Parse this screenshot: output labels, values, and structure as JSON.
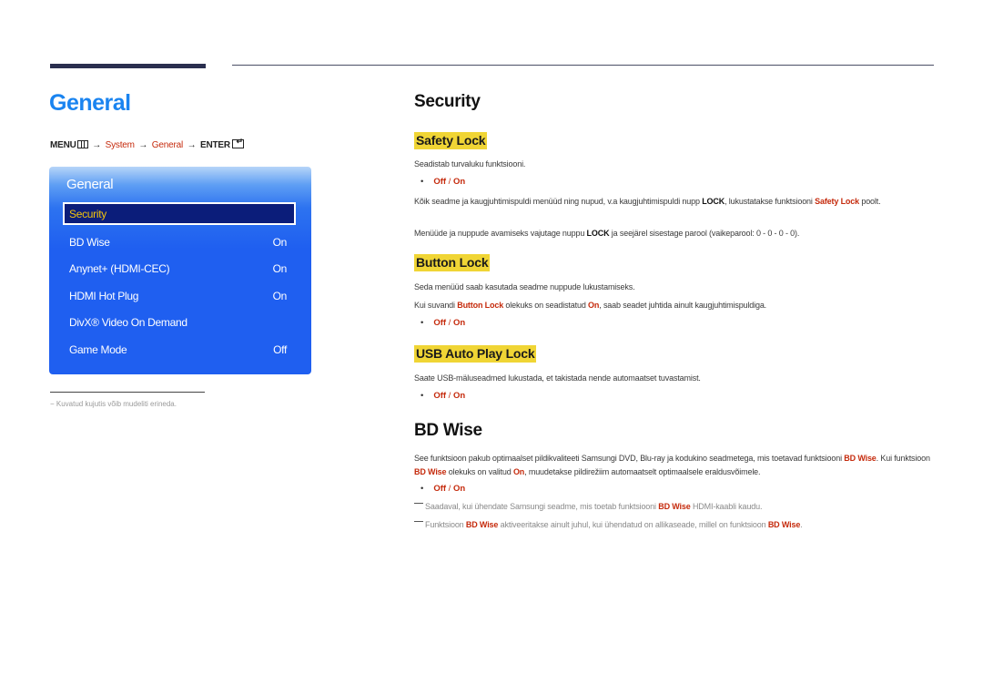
{
  "left": {
    "title": "General",
    "menu_path": {
      "menu": "MENU",
      "arrow": "→",
      "system": "System",
      "general": "General",
      "enter": "ENTER"
    },
    "osd": {
      "title": "General",
      "items": [
        {
          "label": "Security",
          "value": "",
          "selected": true
        },
        {
          "label": "BD Wise",
          "value": "On"
        },
        {
          "label": "Anynet+ (HDMI-CEC)",
          "value": "On"
        },
        {
          "label": "HDMI Hot Plug",
          "value": "On"
        },
        {
          "label": "DivX® Video On Demand",
          "value": ""
        },
        {
          "label": "Game Mode",
          "value": "Off"
        }
      ]
    },
    "footnote": "−  Kuvatud kujutis võib mudeliti erineda."
  },
  "security": {
    "title": "Security",
    "safety_lock": {
      "title": "Safety Lock",
      "desc": "Seadistab turvaluku funktsiooni.",
      "options": {
        "off": "Off",
        "sep": " / ",
        "on": "On"
      },
      "para1_a": "Kõik seadme ja kaugjuhtimispuldi menüüd ning nupud, v.a kaugjuhtimispuldi nupp ",
      "para1_lock": "LOCK",
      "para1_b": ", lukustatakse funktsiooni ",
      "para1_red": "Safety Lock",
      "para1_c": " poolt.",
      "para2_a": "Menüüde ja nuppude avamiseks vajutage nuppu ",
      "para2_lock": "LOCK",
      "para2_b": " ja seejärel sisestage parool (vaikeparool: 0 - 0 - 0 - 0)."
    },
    "button_lock": {
      "title": "Button Lock",
      "desc": "Seda menüüd saab kasutada seadme nuppude lukustamiseks.",
      "para_a": "Kui suvandi ",
      "para_red1": "Button Lock",
      "para_b": " olekuks on seadistatud ",
      "para_red2": "On",
      "para_c": ", saab seadet juhtida ainult kaugjuhtimispuldiga.",
      "options": {
        "off": "Off",
        "sep": " / ",
        "on": "On"
      }
    },
    "usb_lock": {
      "title": "USB Auto Play Lock",
      "desc": "Saate USB-mäluseadmed lukustada, et takistada nende automaatset tuvastamist.",
      "options": {
        "off": "Off",
        "sep": " / ",
        "on": "On"
      }
    }
  },
  "bd_wise": {
    "title": "BD Wise",
    "para_a": "See funktsioon pakub optimaalset pildikvaliteeti Samsungi DVD, Blu-ray ja kodukino seadmetega, mis toetavad funktsiooni ",
    "para_red1": "BD Wise",
    "para_b": ". Kui funktsioon ",
    "para_red2": "BD Wise",
    "para_c": " olekuks on valitud ",
    "para_red3": "On",
    "para_d": ", muudetakse pildirežiim automaatselt optimaalsele eraldusvõimele.",
    "options": {
      "off": "Off",
      "sep": " / ",
      "on": "On"
    },
    "note1_a": "Saadaval, kui ühendate Samsungi seadme, mis toetab funktsiooni ",
    "note1_red": "BD Wise",
    "note1_b": " HDMI-kaabli kaudu.",
    "note2_a": "Funktsioon ",
    "note2_red1": "BD Wise",
    "note2_b": " aktiveeritakse ainult juhul, kui ühendatud on allikaseade, millel on funktsioon ",
    "note2_red2": "BD Wise",
    "note2_c": "."
  },
  "colors": {
    "title_blue": "#1a84f0",
    "accent_red": "#c52a0c",
    "highlight_yellow": "#f0d535",
    "osd_blue": "#1f5ff0",
    "osd_selected": "#0b1d7a",
    "osd_selected_text": "#f3c40c"
  }
}
